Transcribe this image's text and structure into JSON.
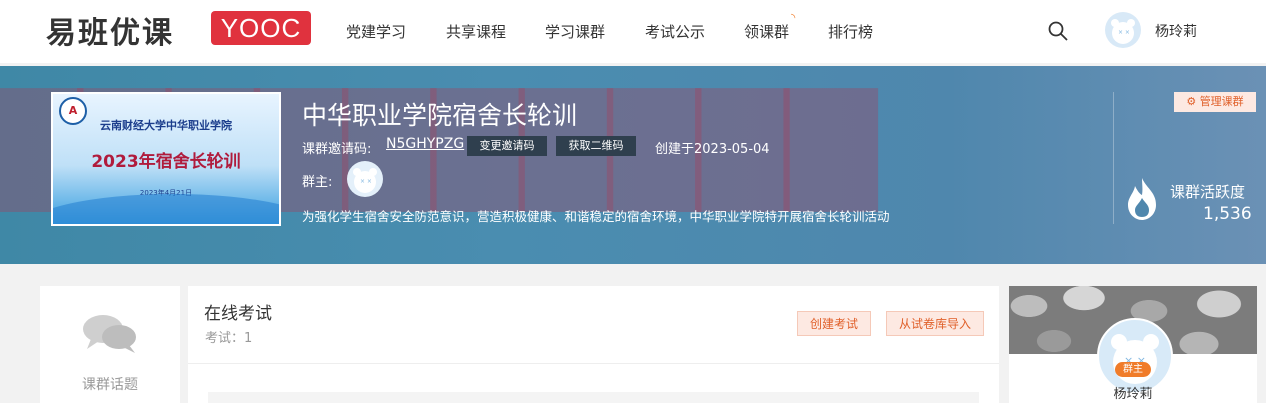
{
  "header": {
    "logo_text": "易班优课",
    "logo_badge": "YOOC",
    "nav": [
      "党建学习",
      "共享课程",
      "学习课群",
      "考试公示",
      "领课群",
      "排行榜"
    ],
    "username": "杨玲莉"
  },
  "course": {
    "cover": {
      "school": "云南财经大学中华职业学院",
      "title": "2023年宿舍长轮训",
      "date": "2023年4月21日"
    },
    "title": "中华职业学院宿舍长轮训",
    "invite_label": "课群邀请码:",
    "invite_code": "N5GHYPZG",
    "change_invite_btn": "变更邀请码",
    "get_qr_btn": "获取二维码",
    "created": "创建于2023-05-04",
    "owner_label": "群主:",
    "description": "为强化学生宿舍安全防范意识，营造积极健康、和谐稳定的宿舍环境，中华职业学院特开展宿舍长轮训活动",
    "manage_btn": "管理课群",
    "activity_label": "课群活跃度",
    "activity_value": "1,536"
  },
  "sidebar": {
    "topics_label": "课群话题"
  },
  "main": {
    "title": "在线考试",
    "exam_count": "考试：1",
    "create_exam_btn": "创建考试",
    "import_btn": "从试卷库导入"
  },
  "owner_card": {
    "tag": "群主",
    "name": "杨玲莉"
  },
  "colors": {
    "brand_red": "#e0323e",
    "accent_orange": "#e0602a"
  }
}
